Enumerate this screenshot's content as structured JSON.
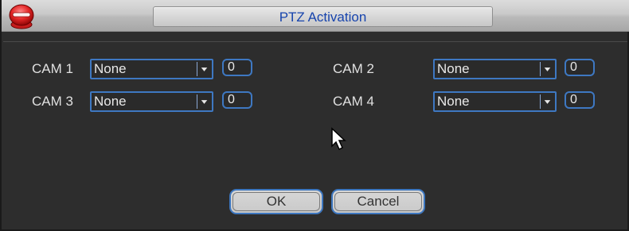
{
  "title": "PTZ Activation",
  "cams": [
    {
      "label": "CAM 1",
      "value": "None",
      "number": "0"
    },
    {
      "label": "CAM 2",
      "value": "None",
      "number": "0"
    },
    {
      "label": "CAM 3",
      "value": "None",
      "number": "0"
    },
    {
      "label": "CAM 4",
      "value": "None",
      "number": "0"
    }
  ],
  "buttons": {
    "ok": "OK",
    "cancel": "Cancel"
  },
  "colors": {
    "title": "#1744ad",
    "accent": "#3e78c2",
    "background": "#2d2d2d"
  }
}
